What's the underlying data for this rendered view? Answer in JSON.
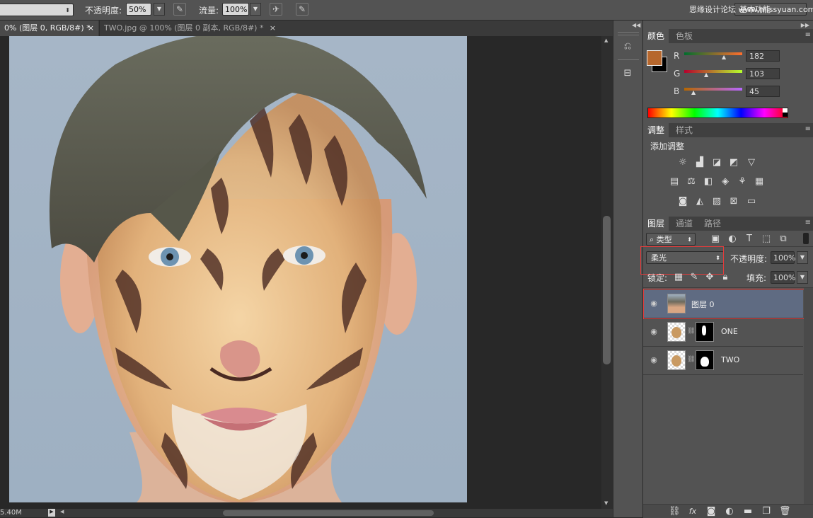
{
  "options_bar": {
    "opacity_label": "不透明度:",
    "opacity_value": "50%",
    "flow_label": "流量:",
    "flow_value": "100%",
    "workspace": "基本功能",
    "watermark": "思缘设计论坛 www.missyuan.com"
  },
  "tabs": [
    {
      "label": "0% (图层 0, RGB/8#) *",
      "close": "×"
    },
    {
      "label": "TWO.jpg @ 100% (图层 0 副本, RGB/8#) *",
      "close": "×"
    }
  ],
  "status_bar": {
    "doc_size": "5.40M"
  },
  "color_panel": {
    "tabs": [
      "颜色",
      "色板"
    ],
    "channels": [
      {
        "label": "R",
        "value": "182"
      },
      {
        "label": "G",
        "value": "103"
      },
      {
        "label": "B",
        "value": "45"
      }
    ],
    "foreground": "#b6672d",
    "background": "#000000"
  },
  "adjust_panel": {
    "tabs": [
      "调整",
      "样式"
    ],
    "title": "添加调整"
  },
  "layers_panel": {
    "tabs": [
      "图层",
      "通道",
      "路径"
    ],
    "filter_kind": "类型",
    "blend_mode": "柔光",
    "opacity_label": "不透明度:",
    "opacity_value": "100%",
    "lock_label": "锁定:",
    "fill_label": "填充:",
    "fill_value": "100%",
    "layers": [
      {
        "name": "图层 0",
        "selected": true
      },
      {
        "name": "ONE",
        "selected": false
      },
      {
        "name": "TWO",
        "selected": false
      }
    ]
  }
}
